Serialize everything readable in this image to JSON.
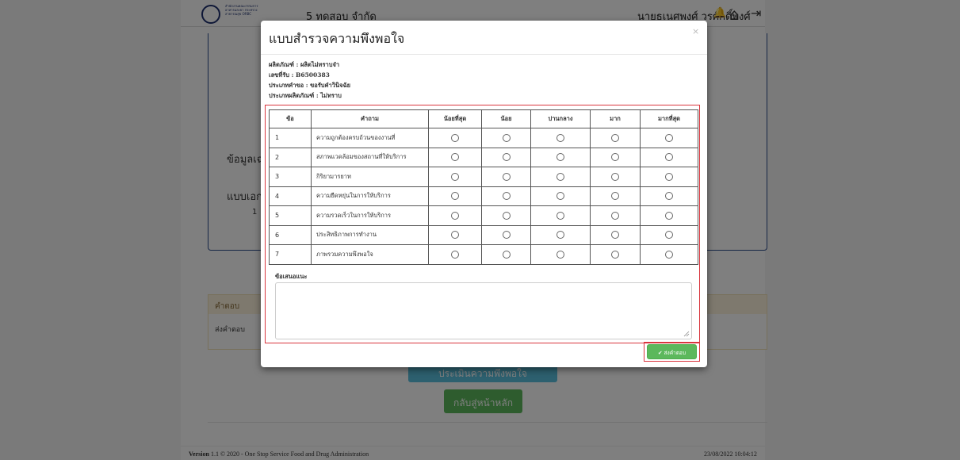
{
  "navbar": {
    "logo_text": "สำนักงานคณะกรรมการอาหารและยา กระทรวงสาธารณสุข ORBC",
    "title": "5 ทดสอบ จำกัด",
    "user": "นายธเนศพงศ์ วรศักดิ์พงศ์"
  },
  "background": {
    "label_personal": "ข้อมูลเฉพ",
    "label_docs": "แบบเอกส",
    "label_one": "1",
    "answer_header": "คำตอบ",
    "answer_row": "ส่งคำตอบ",
    "rate_button": "ประเมินความพึงพอใจ",
    "home_button": "กลับสู่หน้าหลัก"
  },
  "footer": {
    "version_label": "Version",
    "version_text": " 1.1 © 2020 - One Stop Service Food and Drug Administration",
    "datetime": "23/08/2022 10:04:12"
  },
  "modal": {
    "title": "แบบสำรวจความพึงพอใจ",
    "close": "×",
    "info": [
      "ผลิตภัณฑ์ : ผลิตไม่ทราบจำ",
      "เลขที่รับ : B6500383",
      "ประเภทคำขอ : ขอรับคำวินิจฉัย",
      "ประเภทผลิตภัณฑ์ : ไม่ทราบ"
    ],
    "table": {
      "headers": [
        "ข้อ",
        "คำถาม",
        "น้อยที่สุด",
        "น้อย",
        "ปานกลาง",
        "มาก",
        "มากที่สุด"
      ],
      "rows": [
        {
          "no": "1",
          "question": "ความถูกต้องครบถ้วนของงานที่"
        },
        {
          "no": "2",
          "question": "สภาพแวดล้อมของสถานที่ให้บริการ"
        },
        {
          "no": "3",
          "question": "กิริยามารยาท"
        },
        {
          "no": "4",
          "question": "ความยืดหยุ่นในการให้บริการ"
        },
        {
          "no": "5",
          "question": "ความรวดเร็วในการให้บริการ"
        },
        {
          "no": "6",
          "question": "ประสิทธิภาพการทำงาน"
        },
        {
          "no": "7",
          "question": "ภาพรวมความพึงพอใจ"
        }
      ]
    },
    "suggestion_label": "ข้อเสนอแนะ",
    "suggestion_value": "",
    "submit_label": "✔ ส่งคำตอบ"
  },
  "colors": {
    "highlight_border": "#d9363e",
    "success": "#5cb85c",
    "info": "#5bc0de",
    "navy": "#2f4e8e"
  }
}
